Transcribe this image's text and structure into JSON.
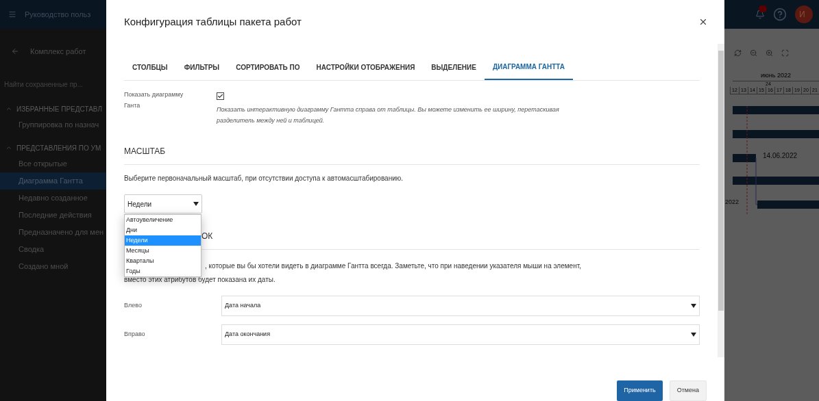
{
  "app_bar": {
    "title": "Руководство польз"
  },
  "sidebar": {
    "back_label": "Комплекс работ",
    "search": {
      "placeholder": "Найти сохраненные пр..."
    },
    "groups": [
      {
        "title": "ИЗБРАННЫЕ ПРЕДСТАВЛ",
        "expanded": true,
        "items": [
          {
            "label": "Группировка по назнач",
            "selected": false
          }
        ]
      },
      {
        "title": "ПРЕДСТАВЛЕНИЯ ПО УМ",
        "expanded": true,
        "items": [
          {
            "label": "Все открытые",
            "selected": false
          },
          {
            "label": "Диаграмма Гантта",
            "selected": true
          },
          {
            "label": "Недавно созданное",
            "selected": false
          },
          {
            "label": "Последние действия",
            "selected": false
          },
          {
            "label": "Предназначено для мен",
            "selected": false
          },
          {
            "label": "Сводка",
            "selected": false
          },
          {
            "label": "Создано мной",
            "selected": false
          }
        ]
      }
    ]
  },
  "header_right": {
    "avatar_initial": "И"
  },
  "gantt": {
    "month": "июнь 2022",
    "week": "24",
    "days": [
      "12",
      "13",
      "14",
      "15",
      "16",
      "17",
      "18",
      "19",
      "20",
      "21"
    ],
    "date_label": "14.06.2022",
    "cut_label": "2022"
  },
  "dialog": {
    "title": "Конфигурация таблицы пакета работ",
    "tabs": [
      {
        "label": "СТОЛБЦЫ",
        "selected": false
      },
      {
        "label": "ФИЛЬТРЫ",
        "selected": false
      },
      {
        "label": "СОРТИРОВАТЬ ПО",
        "selected": false
      },
      {
        "label": "НАСТРОЙКИ ОТОБРАЖЕНИЯ",
        "selected": false
      },
      {
        "label": "ВЫДЕЛЕНИЕ",
        "selected": false
      },
      {
        "label": "ДИАГРАММА ГАНТТА",
        "selected": true
      }
    ],
    "show_gantt": {
      "label": "Показать диаграмму Ганта",
      "checked": true,
      "help": "Показать интерактивную диаграмму Гантта справа от таблицы. Вы можете изменить ее ширину, перетаскивая разделитель между ней и таблицей."
    },
    "scale": {
      "heading": "МАСШТАБ",
      "description": "Выберите первоначальный масштаб, при отсутствии доступа к автомасштабированию.",
      "value": "Недели",
      "options": [
        {
          "label": "Автоувеличение",
          "selected": false
        },
        {
          "label": "Дни",
          "selected": false
        },
        {
          "label": "Недели",
          "selected": true
        },
        {
          "label": "Месяцы",
          "selected": false
        },
        {
          "label": "Кварталы",
          "selected": false
        },
        {
          "label": "Годы",
          "selected": false
        }
      ]
    },
    "labels": {
      "heading": "ОК",
      "text_line_1": ", которые вы бы хотели видеть в диаграмме Гантта всегда. Заметьте, что при наведении указателя мыши на элемент,",
      "text_line_2": "вместо этих атрибутов будет показана их даты.",
      "fields": [
        {
          "label": "Влево",
          "value": "Дата начала"
        },
        {
          "label": "Вправо",
          "value": "Дата окончания"
        }
      ]
    },
    "buttons": [
      {
        "label": "Применить",
        "kind": "primary"
      },
      {
        "label": "Отмена",
        "kind": "secondary"
      }
    ]
  }
}
